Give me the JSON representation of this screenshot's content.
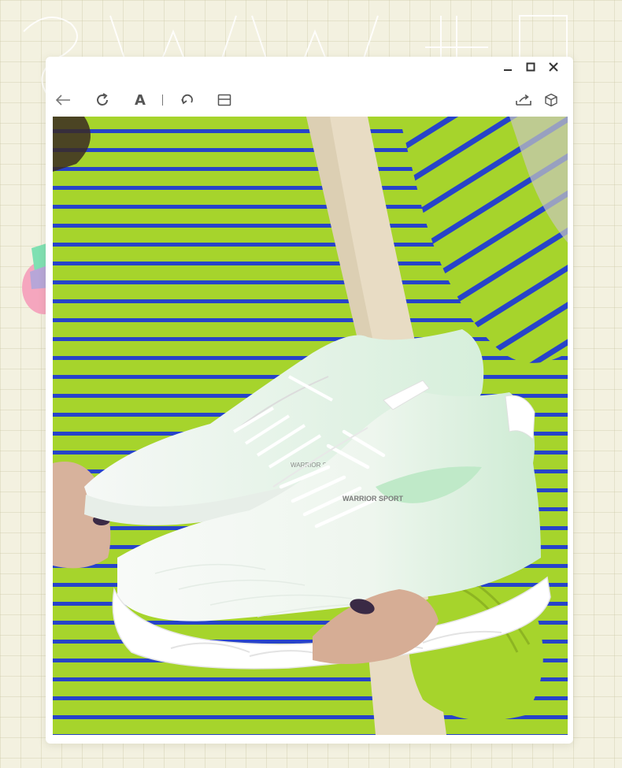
{
  "window": {
    "controls": [
      "minimize",
      "maximize",
      "close"
    ]
  },
  "toolbar": {
    "tools": [
      "back-arrow",
      "refresh",
      "text",
      "undo",
      "layout"
    ],
    "text_tool_label": "A",
    "right_tools": [
      "export",
      "3d-box"
    ]
  },
  "photo": {
    "shoe_brand_text": "WARRIOR SPORT",
    "shoe_back_brand_text": "WARRIOR SPORT",
    "colors": {
      "stripe_green": "#a6d42c",
      "stripe_blue": "#2743c9",
      "shoe_white": "#f7f9f7",
      "shoe_mint": "#bfe9c8",
      "strap_cream": "#e8dcc4"
    }
  }
}
